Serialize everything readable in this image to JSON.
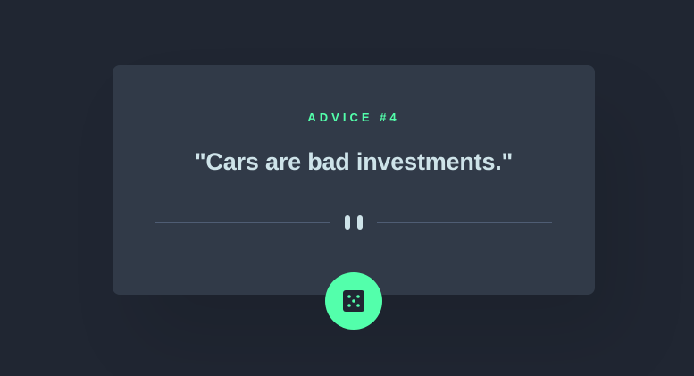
{
  "advice": {
    "label": "ADVICE #4",
    "quote": "\"Cars are bad investments.\""
  },
  "divider": {
    "icon": "pause-icon"
  },
  "button": {
    "icon": "dice-icon"
  },
  "colors": {
    "background": "#202632",
    "card": "#313a48",
    "accent": "#53ffab",
    "text": "#cee3e9",
    "divider": "#4f5d74"
  }
}
